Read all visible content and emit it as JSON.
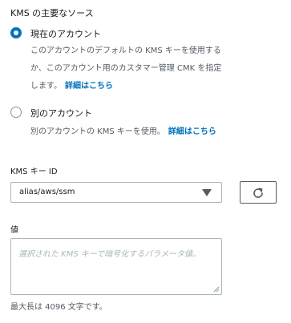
{
  "kms_source": {
    "title": "KMS の主要なソース",
    "options": [
      {
        "label": "現在のアカウント",
        "checked": true,
        "description_lines": [
          "このアカウントのデフォルトの KMS キーを使用するか、このアカウント用のカスタマー管理 CMK を指定",
          "します。"
        ],
        "description_line1": "このアカウントのデフォルトの KMS キーを使用する",
        "description_line2": "か、このアカウント用のカスタマー管理 CMK を指定",
        "description_line3": "します。",
        "link": "詳細はこちら"
      },
      {
        "label": "別のアカウント",
        "checked": false,
        "description": "別のアカウントの KMS キーを使用。",
        "link": "詳細はこちら"
      }
    ]
  },
  "kms_key": {
    "label": "KMS キー ID",
    "selected": "alias/aws/ssm",
    "refresh_icon": "refresh-icon"
  },
  "value_field": {
    "label": "値",
    "placeholder": "選択された KMS キーで暗号化するパラメータ値。",
    "hint": "最大長は 4096 文字です。"
  },
  "colors": {
    "accent": "#0073bb",
    "text": "#16191f",
    "secondary_text": "#545b64",
    "border": "#aab7b8"
  }
}
